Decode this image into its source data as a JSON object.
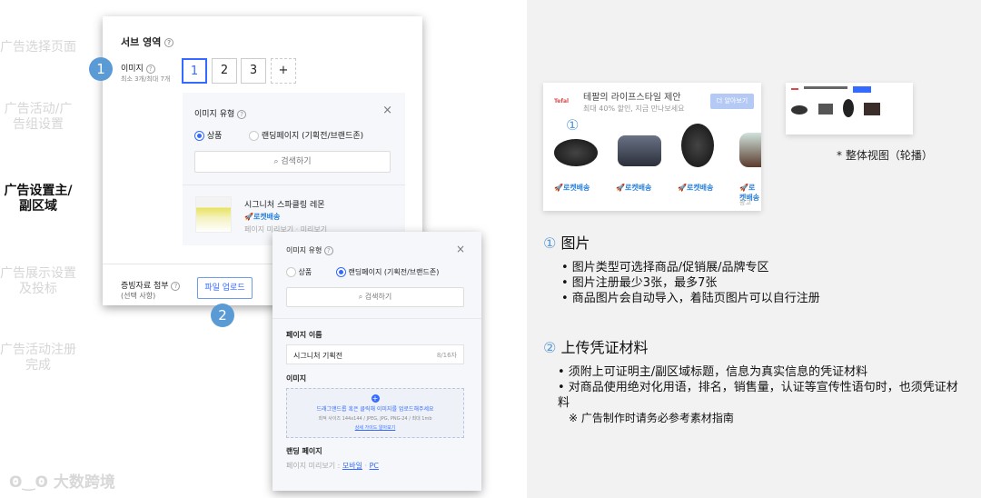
{
  "steps": [
    "广告选择页面",
    "广告活动/广告组设置",
    "广告设置主/副区域",
    "广告展示设置及投标",
    "广告活动注册完成"
  ],
  "form": {
    "section_title": "서브 영역",
    "image_label": "이미지",
    "image_hint": "최소 3개/최대 7개",
    "image_slots": [
      "1",
      "2",
      "3",
      "+"
    ],
    "popup1": {
      "title": "이미지 유형",
      "close": "×",
      "radio_product": "상품",
      "radio_landing": "랜딩페이지 (기획전/브랜드존)",
      "search": "검색하기",
      "product_name": "시그니처 스파클링 레몬",
      "product_badge": "🚀로켓배송",
      "product_preview": "페이지 미리보기 · 미리보기"
    },
    "attach_label": "증빙자료 첨부",
    "attach_hint": "(선택 사항)",
    "upload_button": "파일 업로드"
  },
  "popup2": {
    "title": "이미지 유형",
    "close": "×",
    "radio_product": "상품",
    "radio_landing": "랜딩페이지 (기획전/브랜드존)",
    "search": "검색하기",
    "page_name_label": "페이지 이름",
    "page_name_value": "시그니처 기획전",
    "page_name_count": "8/16자",
    "image_label": "이미지",
    "upload_text": "드래그앤드롭 혹은 클릭해 이미지를 업로드해주세요",
    "upload_spec": "최적 사이즈 144x144 / JPEG, JPG, PNG-24 / 최대 1mb",
    "upload_guide": "상세 가이드 알아보기",
    "landing_label": "랜딩 페이지",
    "preview_label": "페이지 미리보기 :",
    "preview_mobile": "모바일",
    "preview_sep": "·",
    "preview_pc": "PC"
  },
  "badges": [
    "1",
    "2"
  ],
  "ad": {
    "brand": "Tefal",
    "title": "테팔의 라이프스타일 제안",
    "subtitle": "최대 40% 할인, 지금 만나보세요",
    "cta": "더 알아보기",
    "marker": "①",
    "delivery": "🚀로켓배송",
    "ad_label": "광고"
  },
  "overview_caption": "* 整体视图（轮播）",
  "notes": {
    "s1_num": "①",
    "s1_title": "图片",
    "s1_items": [
      "• 图片类型可选择商品/促销展/品牌专区",
      "• 图片注册最少3张，最多7张",
      "• 商品图片会自动导入，着陆页图片可以自行注册"
    ],
    "s2_num": "②",
    "s2_title": "上传凭证材料",
    "s2_items": [
      "• 须附上可证明主/副区域标题，信息为真实信息的凭证材料",
      "• 对商品使用绝对化用语，排名，销售量，认证等宣传性语句时，也须凭证材料"
    ],
    "s2_note": "※ 广告制作时请务必参考素材指南"
  },
  "watermark": "大数跨境",
  "colors": {
    "accent": "#346aff",
    "badge": "#5b9bd5"
  }
}
